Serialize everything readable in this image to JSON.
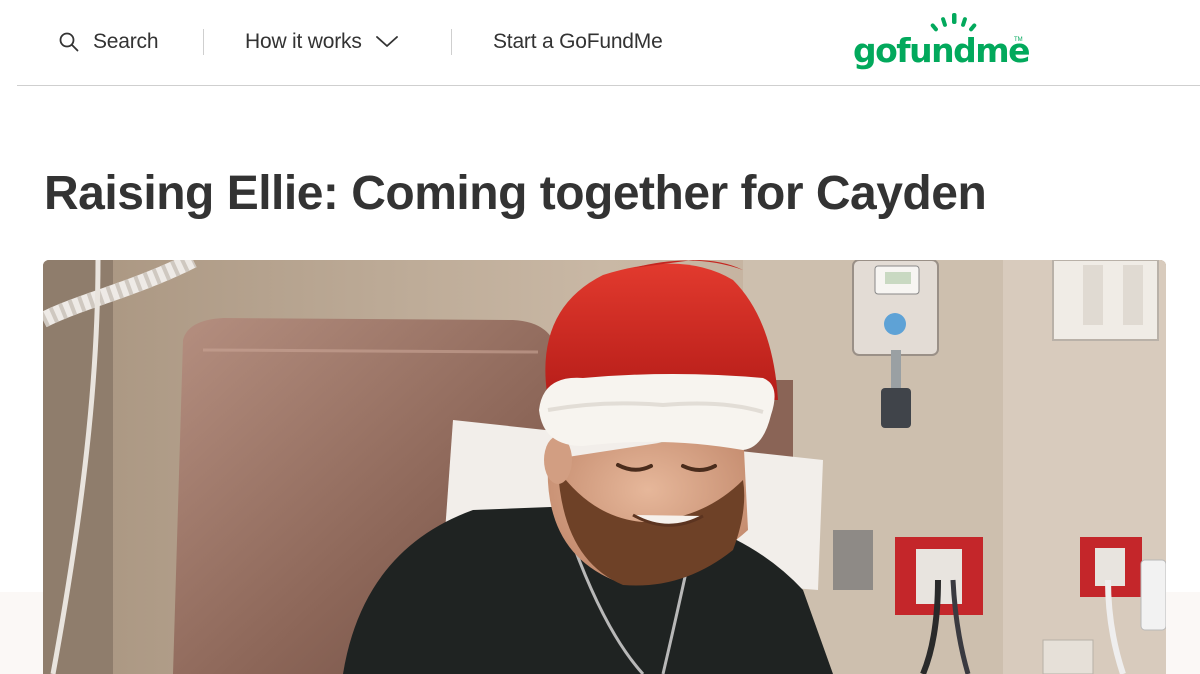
{
  "header": {
    "search_label": "Search",
    "how_it_works_label": "How it works",
    "start_label": "Start a GoFundMe",
    "logo_text": "gofundme",
    "logo_tm": "TM"
  },
  "campaign": {
    "title": "Raising Ellie: Coming together for Cayden"
  },
  "colors": {
    "brand_green": "#02a95c",
    "text": "#333333",
    "divider": "#cfcfcf"
  },
  "icons": {
    "search": "search-icon",
    "how_it_works": "chevron-down-icon"
  }
}
